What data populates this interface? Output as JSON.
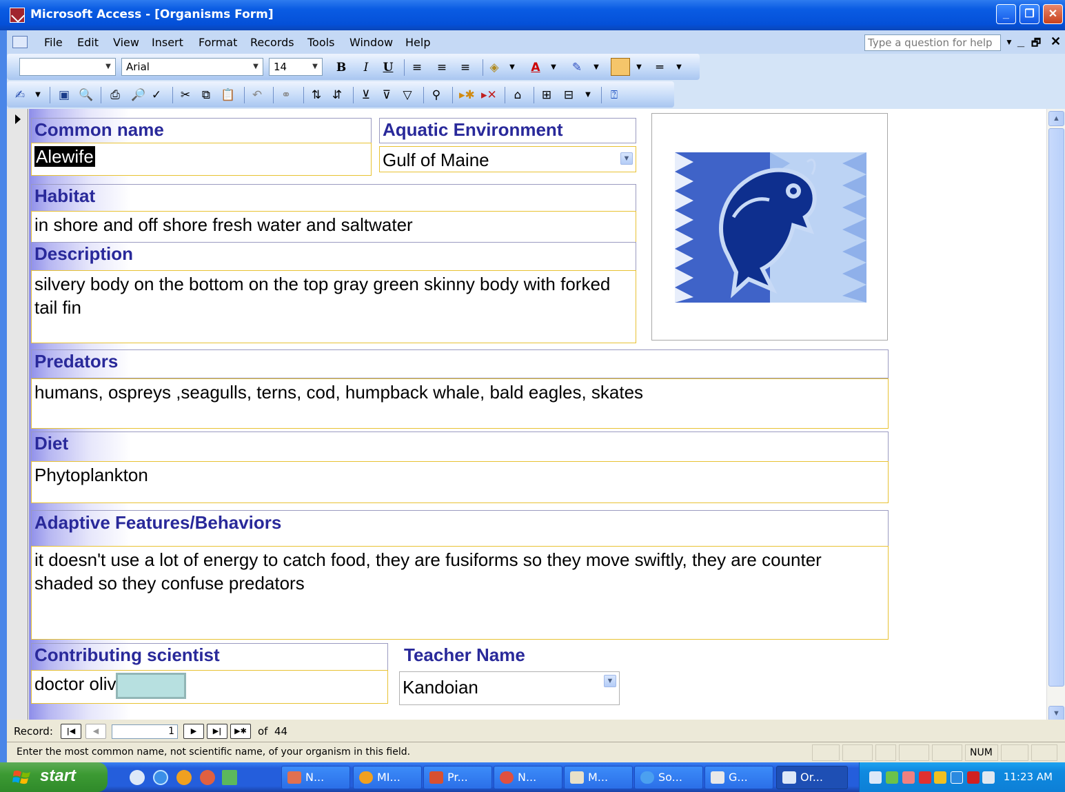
{
  "window": {
    "title": "Microsoft Access - [Organisms Form]",
    "minimize": "_",
    "restore": "❐",
    "close": "✕"
  },
  "menubar": {
    "items": [
      "File",
      "Edit",
      "View",
      "Insert",
      "Format",
      "Records",
      "Tools",
      "Window",
      "Help"
    ],
    "help_placeholder": "Type a question for help"
  },
  "format_toolbar": {
    "object_combo": "",
    "font_name": "Arial",
    "font_size": "14",
    "bold": "B",
    "italic": "I",
    "underline": "U"
  },
  "form": {
    "common_name_label": "Common name",
    "common_name_value": "Alewife",
    "aquatic_env_label": "Aquatic Environment",
    "aquatic_env_value": "Gulf of Maine",
    "habitat_label": "Habitat",
    "habitat_value": "in shore and off shore fresh water and saltwater",
    "description_label": "Description",
    "description_value": "silvery body on the bottom on the top gray green skinny body with forked tail fin",
    "predators_label": "Predators",
    "predators_value": "humans, ospreys ,seagulls, terns, cod, humpback whale, bald eagles, skates",
    "diet_label": "Diet",
    "diet_value": "Phytoplankton",
    "adaptive_label": "Adaptive Features/Behaviors",
    "adaptive_value": "it doesn't use a lot of energy to catch food, they are fusiforms so they move swiftly, they are counter shaded so they confuse predators",
    "scientist_label": "Contributing scientist",
    "scientist_value": "doctor olivia",
    "teacher_label": "Teacher Name",
    "teacher_value": "Kandoian"
  },
  "record_nav": {
    "label": "Record:",
    "current": "1",
    "of_label": "of",
    "total": "44"
  },
  "status": {
    "message": "Enter the most common name, not scientific name, of your organism in this field.",
    "num": "NUM"
  },
  "taskbar": {
    "start": "start",
    "tasks": [
      "N...",
      "MI...",
      "Pr...",
      "N...",
      "M...",
      "So...",
      "G...",
      "Or..."
    ],
    "clock": "11:23 AM"
  },
  "colors": {
    "label_text": "#29299a",
    "field_border": "#e8c232",
    "title_bar": "#0a5ce3"
  }
}
